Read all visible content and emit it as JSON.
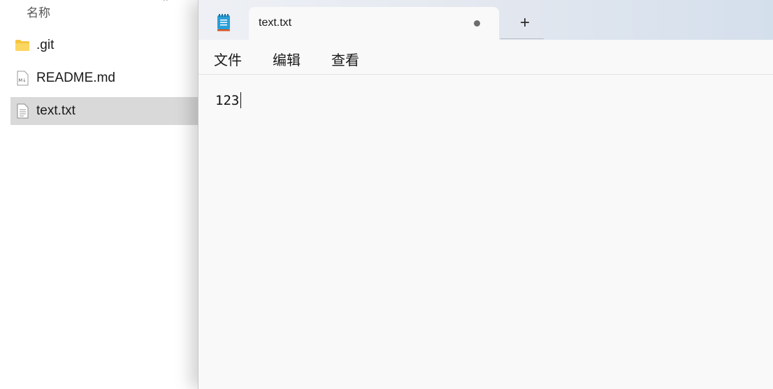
{
  "explorer": {
    "column_header": "名称",
    "sort_indicator": "^",
    "files": [
      {
        "name": ".git",
        "icon": "folder-icon",
        "selected": false
      },
      {
        "name": "README.md",
        "icon": "markdown-file-icon",
        "selected": false
      },
      {
        "name": "text.txt",
        "icon": "text-file-icon",
        "selected": true
      }
    ]
  },
  "notepad": {
    "tab": {
      "title": "text.txt",
      "unsaved_indicator": "dot"
    },
    "new_tab_label": "+",
    "menu": {
      "file": "文件",
      "edit": "编辑",
      "view": "查看"
    },
    "content": "123"
  },
  "colors": {
    "selection": "#d9d9d9",
    "notepad_bg": "#f9f9f9",
    "folder": "#f5c542",
    "app_icon_blue": "#2a9fd8",
    "app_icon_orange": "#d9541e"
  }
}
